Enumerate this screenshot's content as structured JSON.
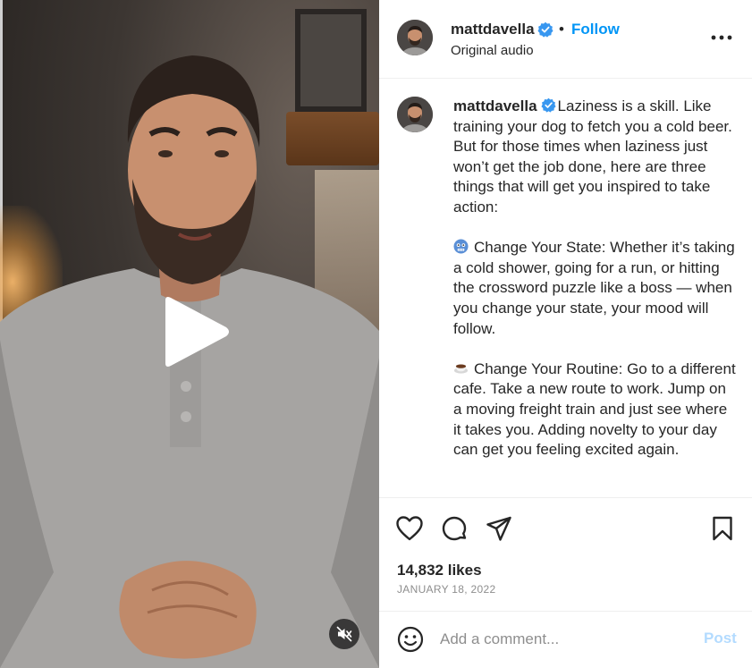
{
  "header": {
    "username": "mattdavella",
    "separator": "•",
    "follow_label": "Follow",
    "audio_label": "Original audio"
  },
  "caption": {
    "username": "mattdavella",
    "intro": "Laziness is a skill. Like training your dog to fetch you a cold beer. But for those times when laziness just won’t get the job done, here are three things that will get you inspired to take action:",
    "point1": "Change Your State: Whether it’s taking a cold shower, going for a run, or hitting the crossword puzzle like a boss — when you change your state, your mood will follow.",
    "point2": "Change Your Routine: Go to a different cafe. Take a new route to work. Jump on a moving freight train and just see where it takes you. Adding novelty to your day can get you feeling excited again."
  },
  "actions": {
    "likes": "14,832 likes",
    "date": "JANUARY 18, 2022"
  },
  "comment": {
    "placeholder": "Add a comment...",
    "value": "",
    "post_label": "Post"
  },
  "icons": {
    "verified": "verified-badge-icon",
    "more": "more-options-icon",
    "emoji1": "cold-face-emoji-icon",
    "emoji2": "coffee-emoji-icon",
    "like": "heart-icon",
    "comment": "comment-bubble-icon",
    "share": "paper-plane-icon",
    "save": "bookmark-icon",
    "emoji_picker": "smiley-icon",
    "play": "play-icon",
    "mute": "muted-speaker-icon"
  },
  "colors": {
    "accent": "#0095f6",
    "post_disabled": "#b3dbff",
    "text": "#262626",
    "muted": "#8e8e8e",
    "verified": "#3897f0"
  }
}
